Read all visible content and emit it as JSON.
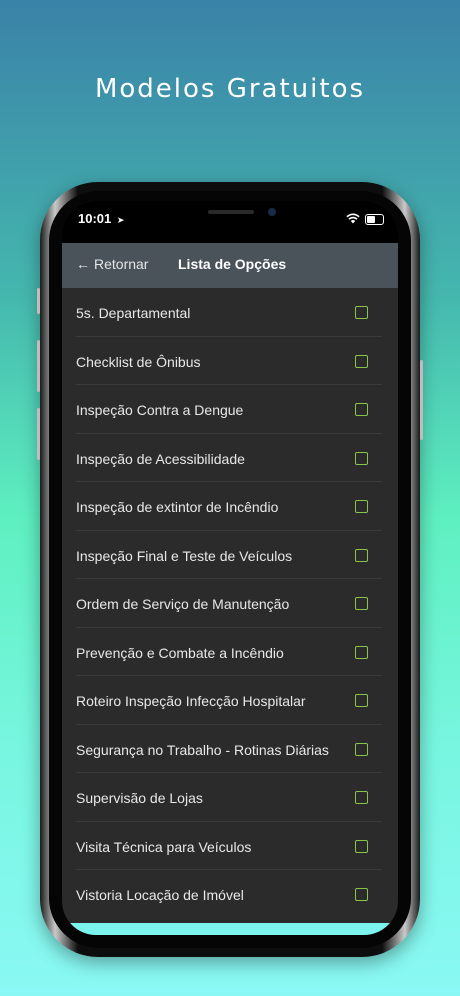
{
  "headline": "Modelos Gratuitos",
  "status_bar": {
    "time": "10:01",
    "location_icon": "location-arrow-icon",
    "wifi_icon": "wifi-icon",
    "battery_icon": "battery-icon"
  },
  "nav": {
    "back_arrow": "←",
    "back_label": "Retornar",
    "title": "Lista de Opções"
  },
  "items": [
    {
      "label": "5s. Departamental",
      "checked": false
    },
    {
      "label": "Checklist de Ônibus",
      "checked": false
    },
    {
      "label": "Inspeção Contra a Dengue",
      "checked": false
    },
    {
      "label": "Inspeção de Acessibilidade",
      "checked": false
    },
    {
      "label": "Inspeção de extintor de Incêndio",
      "checked": false
    },
    {
      "label": "Inspeção Final e Teste de Veículos",
      "checked": false
    },
    {
      "label": "Ordem de Serviço de Manutenção",
      "checked": false
    },
    {
      "label": "Prevenção e Combate a Incêndio",
      "checked": false
    },
    {
      "label": "Roteiro Inspeção Infecção Hospitalar",
      "checked": false
    },
    {
      "label": "Segurança no Trabalho - Rotinas Diárias",
      "checked": false
    },
    {
      "label": "Supervisão de Lojas",
      "checked": false
    },
    {
      "label": "Visita Técnica para Veículos",
      "checked": false
    },
    {
      "label": "Vistoria Locação de Imóvel",
      "checked": false
    }
  ],
  "colors": {
    "background_top": "#3a82a8",
    "background_bottom": "#8af8f4",
    "nav_bar": "#4a525a",
    "list_background": "#2b2b2b",
    "checkbox_border": "#8bc34a"
  }
}
